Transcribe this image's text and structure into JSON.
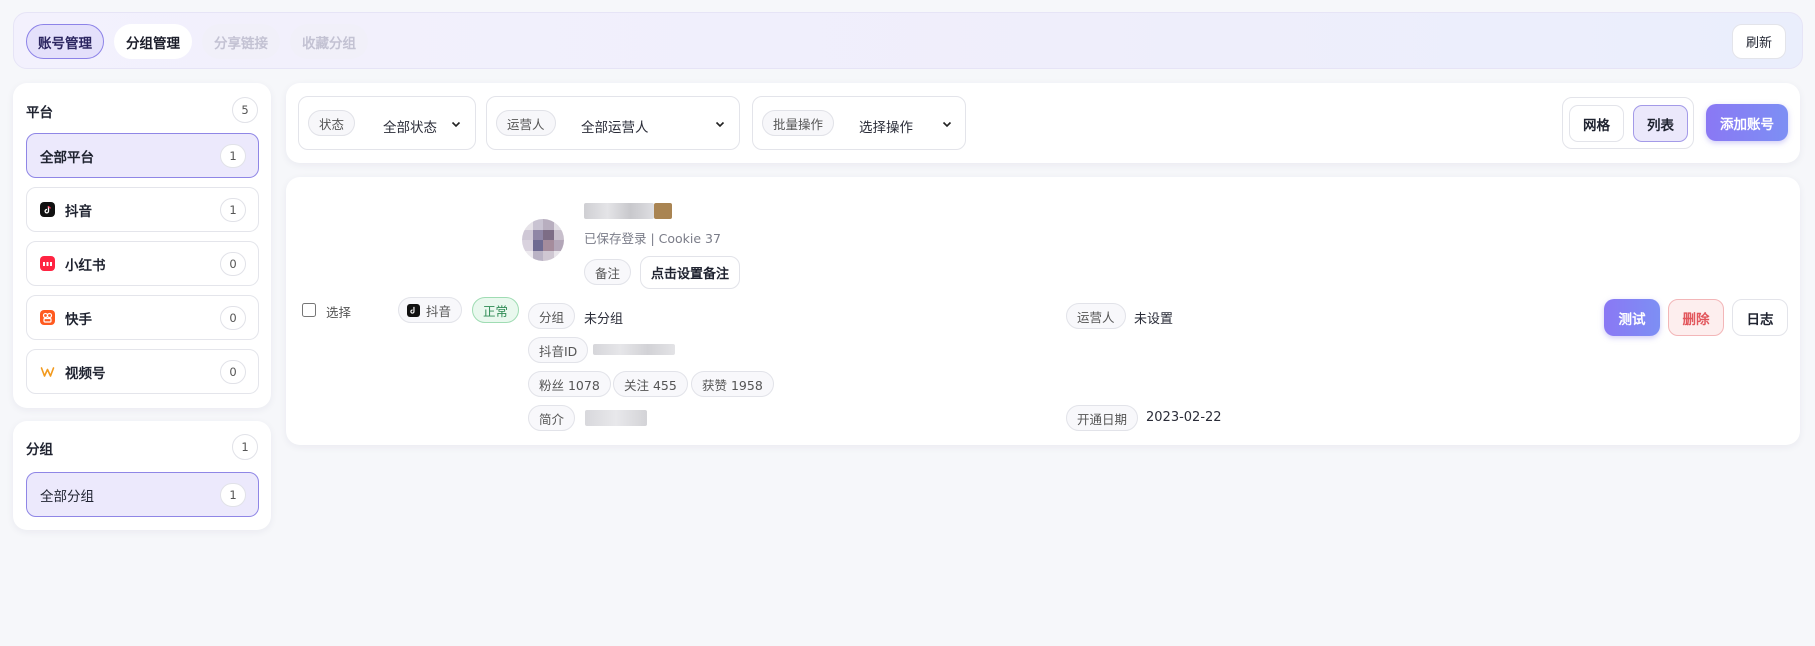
{
  "topnav": {
    "tabs": [
      "账号管理",
      "分组管理",
      "分享链接",
      "收藏分组"
    ],
    "refresh": "刷新"
  },
  "platform_panel": {
    "title": "平台",
    "count": "5",
    "items": [
      {
        "label": "全部平台",
        "count": "1",
        "icon": "none"
      },
      {
        "label": "抖音",
        "count": "1",
        "icon": "douyin-icon"
      },
      {
        "label": "小红书",
        "count": "0",
        "icon": "xiaohongshu-icon"
      },
      {
        "label": "快手",
        "count": "0",
        "icon": "kuaishou-icon"
      },
      {
        "label": "视频号",
        "count": "0",
        "icon": "shipinhao-icon"
      }
    ]
  },
  "group_panel": {
    "title": "分组",
    "count": "1",
    "items": [
      {
        "label": "全部分组",
        "count": "1"
      }
    ]
  },
  "filters": {
    "status_label": "状态",
    "status_value": "全部状态",
    "operator_label": "运营人",
    "operator_value": "全部运营人",
    "batch_label": "批量操作",
    "batch_value": "选择操作",
    "view_grid": "网格",
    "view_list": "列表",
    "add_account": "添加账号"
  },
  "account": {
    "select_label": "选择",
    "platform": "抖音",
    "status": "正常",
    "login_info": "已保存登录 | Cookie 37",
    "note_label": "备注",
    "note_button": "点击设置备注",
    "group_label": "分组",
    "group_value": "未分组",
    "operator_label": "运营人",
    "operator_value": "未设置",
    "douyin_id_label": "抖音ID",
    "fans": "粉丝 1078",
    "following": "关注 455",
    "likes": "获赞 1958",
    "bio_label": "简介",
    "open_date_label": "开通日期",
    "open_date_value": "2023-02-22",
    "test_button": "测试",
    "delete_button": "删除",
    "log_button": "日志"
  },
  "colors": {
    "accent": "#8a78f4",
    "accent_light": "#ece9fc",
    "status_green": "#3aa46a",
    "danger": "#e2565c"
  }
}
